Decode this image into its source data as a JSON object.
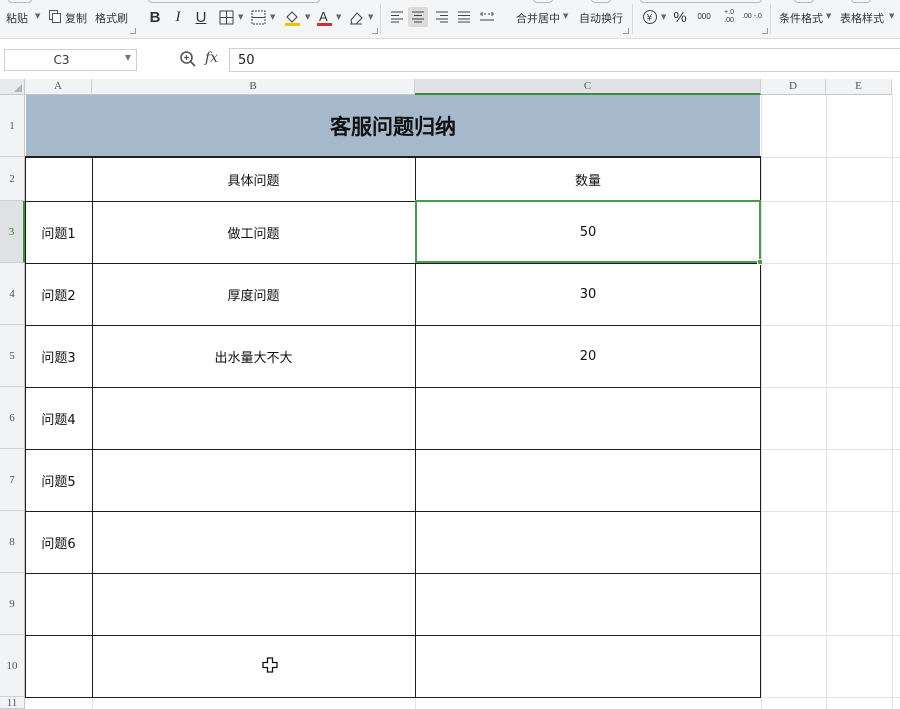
{
  "ribbon": {
    "paste_label": "粘贴",
    "copy_label": "复制",
    "format_painter_label": "格式刷",
    "bold_label": "B",
    "italic_label": "I",
    "underline_label": "U",
    "merge_center_label": "合并居中",
    "wrap_text_label": "自动换行",
    "percent_label": "%",
    "thousands_label": "000",
    "inc_decimal_label": "+.0 .00",
    "dec_decimal_label": ".00 -.0",
    "conditional_format_label": "条件格式",
    "table_style_label": "表格样式",
    "font_color": "#d32f2f"
  },
  "formula_bar": {
    "name_box": "C3",
    "fx_label": "fx",
    "value": "50"
  },
  "columns": [
    "A",
    "B",
    "C",
    "D",
    "E"
  ],
  "rows": [
    "1",
    "2",
    "3",
    "4",
    "5",
    "6",
    "7",
    "8",
    "9",
    "10",
    "11"
  ],
  "sheet": {
    "title": "客服问题归纳",
    "header_b": "具体问题",
    "header_c": "数量",
    "records": [
      {
        "a": "问题1",
        "b": "做工问题",
        "c": "50"
      },
      {
        "a": "问题2",
        "b": "厚度问题",
        "c": "30"
      },
      {
        "a": "问题3",
        "b": "出水量大不大",
        "c": "20"
      },
      {
        "a": "问题4",
        "b": "",
        "c": ""
      },
      {
        "a": "问题5",
        "b": "",
        "c": ""
      },
      {
        "a": "问题6",
        "b": "",
        "c": ""
      },
      {
        "a": "",
        "b": "",
        "c": ""
      },
      {
        "a": "",
        "b": "",
        "c": ""
      }
    ],
    "selected_cell": "C3"
  },
  "colors": {
    "title_fill": "#a6b8cb",
    "selection": "#4a9a4e",
    "ribbon_bg": "#f4f5f7"
  }
}
